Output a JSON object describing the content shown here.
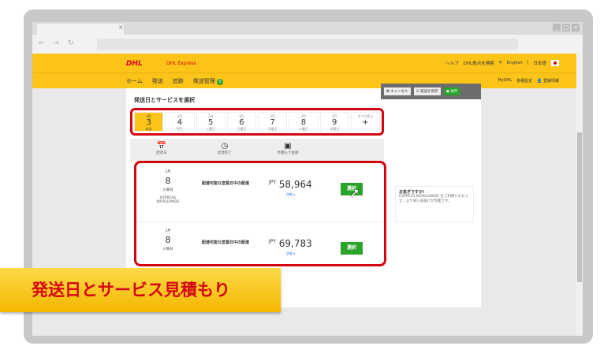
{
  "browser": {
    "nav_glyphs": "← → ↻",
    "tab_close": "×",
    "window_buttons": [
      "_",
      "□",
      "×"
    ]
  },
  "header": {
    "logo": "DHL",
    "brand": "DHL Express",
    "links": [
      "ヘルプ",
      "DHL拠点を検索",
      "|",
      "English",
      "|",
      "日本語"
    ],
    "search_icon": "search-icon"
  },
  "nav": {
    "items": [
      "ホーム",
      "発送",
      "追跡",
      "発送管理"
    ],
    "badge": "0",
    "right": [
      "MyDHL",
      "各種設定",
      "登録情報"
    ]
  },
  "panel": {
    "title": "発送日とサービスを選択",
    "toolbar": [
      "✪ キャンセル",
      "☑ 発送を保存",
      "▣ 保存"
    ]
  },
  "dates": [
    {
      "m": "3月",
      "d": "3",
      "w": "本日",
      "selected": true
    },
    {
      "m": "3月",
      "d": "4",
      "w": "明日"
    },
    {
      "m": "3月",
      "d": "5",
      "w": "土曜日"
    },
    {
      "m": "3月",
      "d": "6",
      "w": "日曜日"
    },
    {
      "m": "3月",
      "d": "7",
      "w": "月曜日"
    },
    {
      "m": "3月",
      "d": "8",
      "w": "火曜日"
    },
    {
      "m": "3月",
      "d": "9",
      "w": "水曜日"
    },
    {
      "m": "すべて表示",
      "d": "+",
      "w": ""
    }
  ],
  "icons": [
    {
      "label": "配達日",
      "glyph": "📅"
    },
    {
      "label": "配達完了",
      "glyph": "◷"
    },
    {
      "label": "見積もり金額",
      "glyph": "▣"
    }
  ],
  "results": [
    {
      "month": "3月",
      "day": "8",
      "weekday": "火曜日",
      "service": "EXPRESS WORLDWIDE",
      "desc": "配達可能な営業日中の配達",
      "currency": "JPY",
      "price": "58,964",
      "detail": "詳細 ▾",
      "button": "選択"
    },
    {
      "month": "3月",
      "day": "8",
      "weekday": "火曜日",
      "service": "",
      "desc": "配達可能な営業日中の配達",
      "currency": "JPY",
      "price": "69,783",
      "detail": "詳細 ▾",
      "button": "選択"
    }
  ],
  "tip": {
    "title": "お急ぎですか!",
    "body": "EXPRESS WORLDWIDE をご利用いただくと、より早いお届けが可能です。"
  },
  "banner": "発送日とサービス見積もり",
  "colors": {
    "dhl_yellow": "#fcc418",
    "dhl_red": "#d40511",
    "select_green": "#2aa32a"
  }
}
